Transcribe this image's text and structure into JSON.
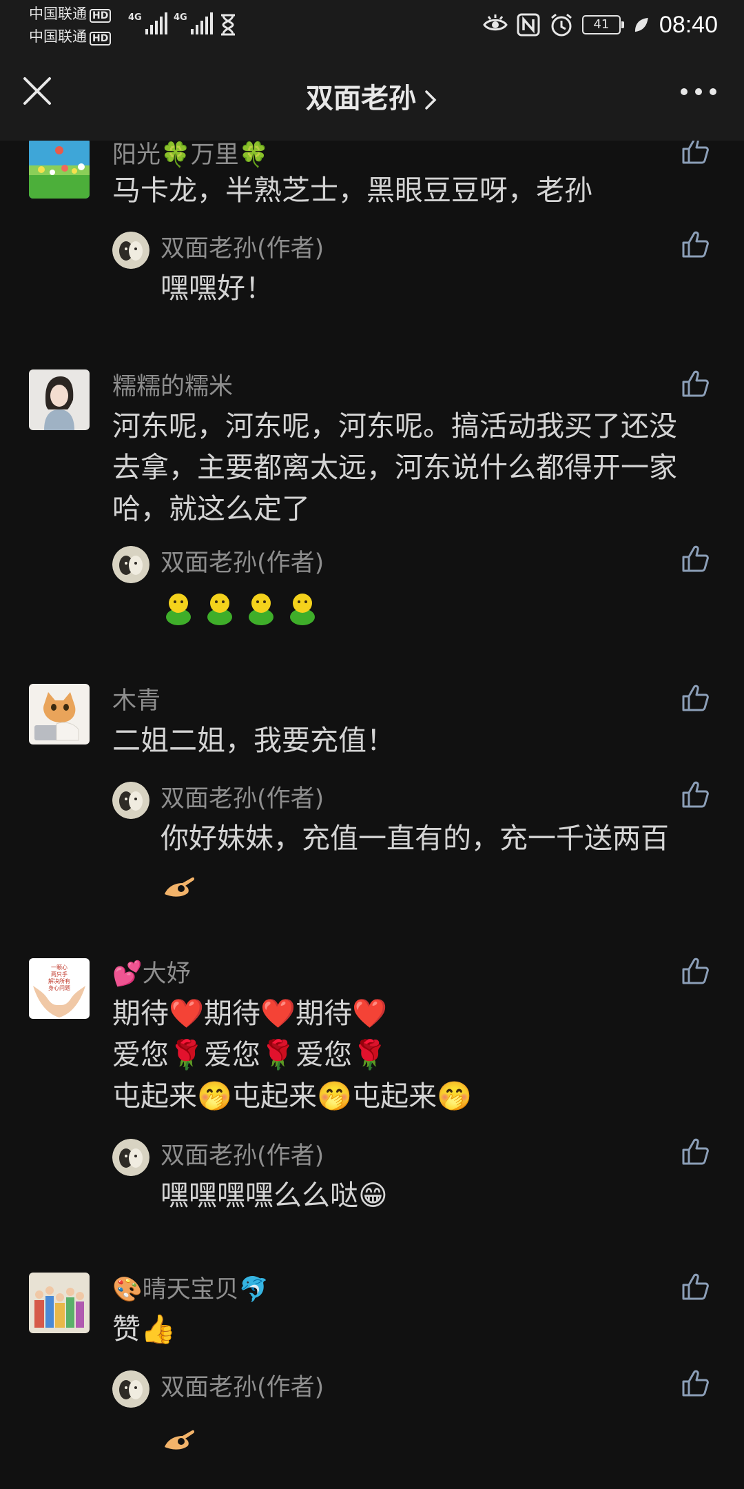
{
  "status_bar": {
    "carrier1": "中国联通",
    "carrier2": "中国联通",
    "hd_label": "HD",
    "net1": "4G",
    "net2": "4G",
    "battery": "41",
    "time": "08:40",
    "icons": [
      "eye-icon",
      "nfc-icon",
      "alarm-icon",
      "battery-icon",
      "leaf-icon"
    ]
  },
  "header": {
    "title": "双面老孙",
    "icons": [
      "close-icon",
      "chevron-right-icon",
      "more-icon"
    ]
  },
  "comments": [
    {
      "name": "阳光🍀万里🍀",
      "text": "马卡龙，半熟芝士，黑眼豆豆呀，老孙",
      "reply": {
        "name": "双面老孙(作者)",
        "text": "嘿嘿好！"
      }
    },
    {
      "name": "糯糯的糯米",
      "text": "河东呢，河东呢，河东呢。搞活动我买了还没去拿，主要都离太远，河东说什么都得开一家哈，就这么定了",
      "reply": {
        "name": "双面老孙(作者)",
        "text": "",
        "emoji": [
          "green-figure-emoji",
          "green-figure-emoji",
          "green-figure-emoji",
          "green-figure-emoji"
        ]
      }
    },
    {
      "name": "木青",
      "text": "二姐二姐，我要充值！",
      "reply": {
        "name": "双面老孙(作者)",
        "text": "你好妹妹，充值一直有的，充一千送两百",
        "emoji": [
          "ok-hand-emoji"
        ]
      }
    },
    {
      "name": "💕大妤",
      "lines": [
        "期待❤️期待❤️期待❤️",
        "爱您🌹爱您🌹爱您🌹",
        "屯起来🤭屯起来🤭屯起来🤭"
      ],
      "avatar_text": "一颗心 两只手 解决所有 身心问题",
      "reply": {
        "name": "双面老孙(作者)",
        "text": "嘿嘿嘿嘿么么哒😁"
      }
    },
    {
      "name": "🎨晴天宝贝🐬",
      "text": "赞👍",
      "reply": {
        "name": "双面老孙(作者)",
        "text": "",
        "emoji": [
          "ok-hand-emoji"
        ]
      }
    }
  ],
  "colors": {
    "background": "#111111",
    "bar": "#1b1b1b",
    "name": "#8e8e8e",
    "text": "#d4d4d4",
    "like_outline": "#8c9fb8"
  }
}
